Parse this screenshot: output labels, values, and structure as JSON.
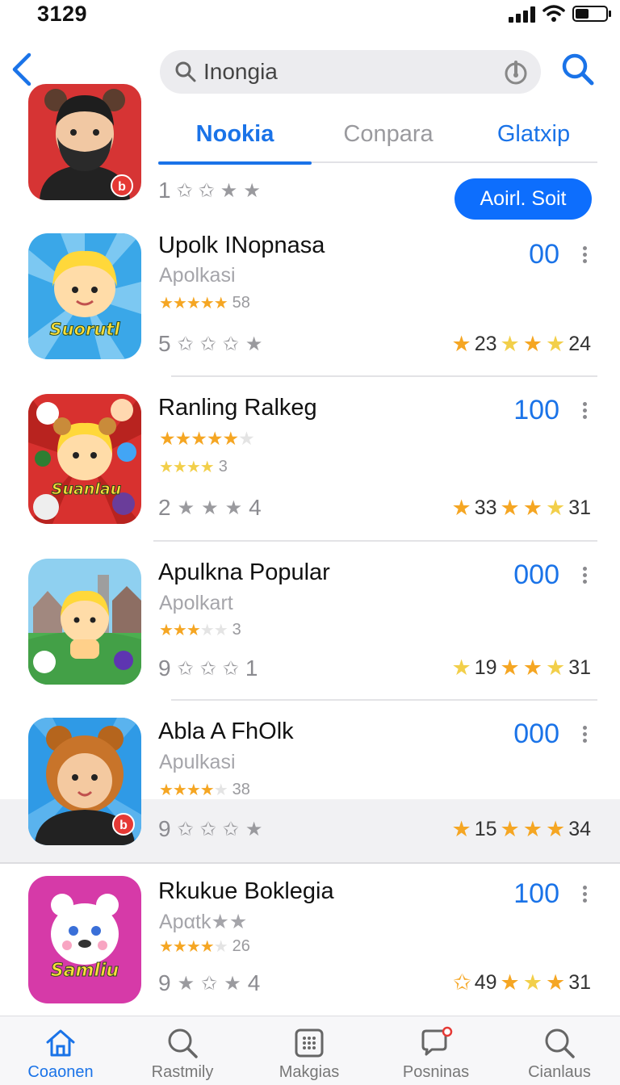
{
  "status_bar": {
    "time": "3129"
  },
  "header": {
    "search": {
      "value": "Inongia"
    }
  },
  "featured": {
    "icon": "bearded-man-avatar-icon",
    "rating_count": "1",
    "button_label": "Aoirl. Soit"
  },
  "tabs": [
    {
      "label": "Nookia",
      "active": true
    },
    {
      "label": "Conpara",
      "active": false
    },
    {
      "label": "Glatxip",
      "active": false
    }
  ],
  "apps": [
    {
      "title": "Upolk INopnasa",
      "subtitle": "Apolkasi",
      "mini_stars": 5,
      "mini_count": "58",
      "price": "00",
      "left_count": "5",
      "rating_a": "23",
      "rating_b": "24",
      "icon": "sunburst-blonde-character-icon",
      "icon_label": "Suorutl"
    },
    {
      "title": "Ranling Ralkeg",
      "subtitle": "",
      "mini_stars": 5,
      "extra_stars": 4,
      "mini_count": "3",
      "price": "100",
      "left_count": "2",
      "left_end": "4",
      "rating_a": "33",
      "rating_b": "31",
      "icon": "red-collage-character-icon",
      "icon_label": "Suanlau"
    },
    {
      "title": "Apulkna Popular",
      "subtitle": "Apolkart",
      "mini_stars": 3,
      "mini_count": "3",
      "price": "000",
      "left_count": "9",
      "left_end": "1",
      "rating_a": "19",
      "rating_b": "31",
      "icon": "village-character-icon",
      "icon_label": ""
    },
    {
      "title": "Abla A FhOlk",
      "subtitle": "Apulkasi",
      "mini_stars": 4,
      "mini_count": "38",
      "price": "000",
      "left_count": "9",
      "rating_a": "15",
      "rating_b": "34",
      "icon": "bear-hood-character-icon",
      "icon_label": ""
    },
    {
      "title": "Rkukue Boklegia",
      "subtitle": "Apαtk★★",
      "mini_stars": 4,
      "mini_count": "26",
      "price": "100",
      "left_count": "9",
      "left_end": "4",
      "rating_a": "49",
      "rating_b": "31",
      "icon": "polar-bear-icon",
      "icon_label": "Samliu"
    }
  ],
  "bottom_nav": [
    {
      "label": "Coaonen",
      "icon": "home-icon",
      "active": true
    },
    {
      "label": "Rastmily",
      "icon": "search-icon",
      "active": false
    },
    {
      "label": "Makgias",
      "icon": "grid-icon",
      "active": false
    },
    {
      "label": "Posninas",
      "icon": "chat-icon",
      "active": false
    },
    {
      "label": "Cianlaus",
      "icon": "search-icon",
      "active": false
    }
  ],
  "colors": {
    "accent": "#1a73e8",
    "button": "#0d6efd",
    "star": "#f5a623"
  }
}
